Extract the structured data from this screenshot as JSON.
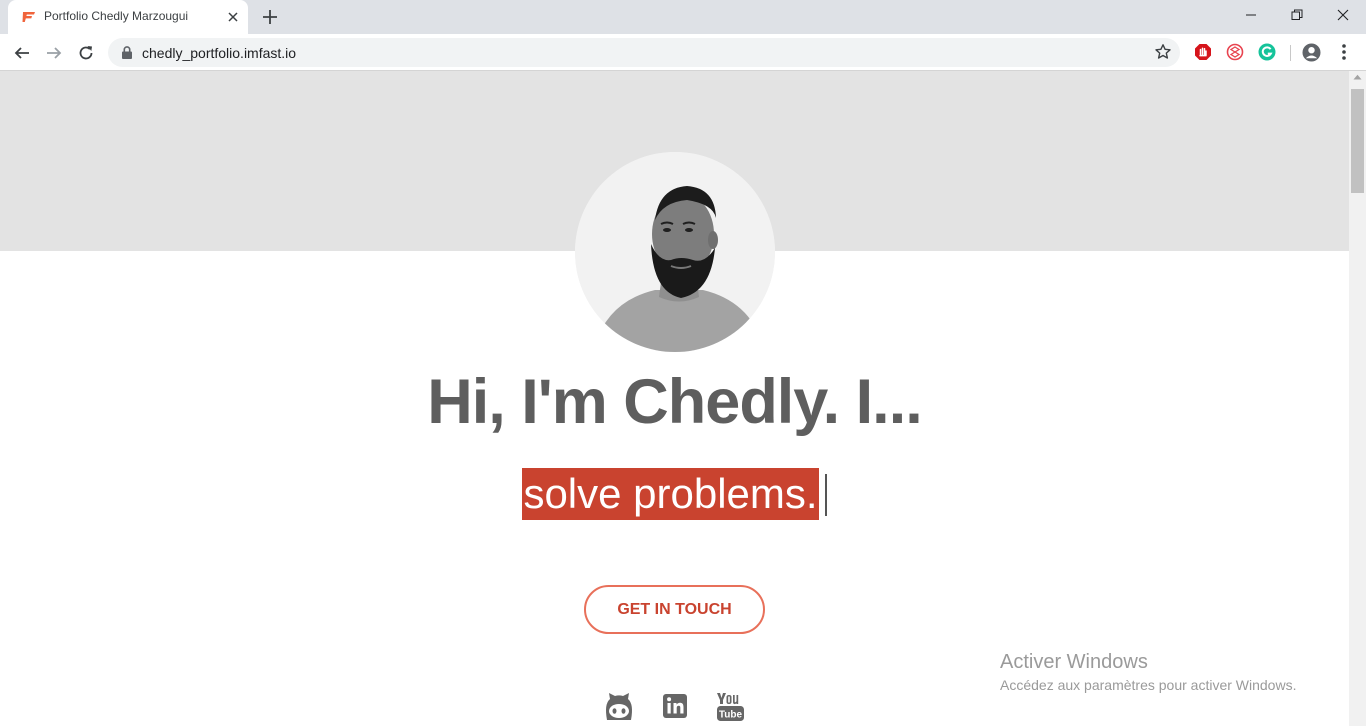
{
  "browser": {
    "tab_title": "Portfolio Chedly Marzougui",
    "url": "chedly_portfolio.imfast.io"
  },
  "page": {
    "headline": "Hi, I'm Chedly. I...",
    "typed_text": "solve problems.",
    "cta_label": "GET IN TOUCH",
    "socials": [
      "github-icon",
      "linkedin-icon",
      "youtube-icon"
    ]
  },
  "watermark": {
    "title": "Activer Windows",
    "subtitle": "Accédez aux paramètres pour activer Windows."
  },
  "colors": {
    "accent": "#c9432f",
    "cta_border": "#e8705a",
    "headline": "#5e5e5e",
    "hero_band": "#e3e3e3"
  }
}
